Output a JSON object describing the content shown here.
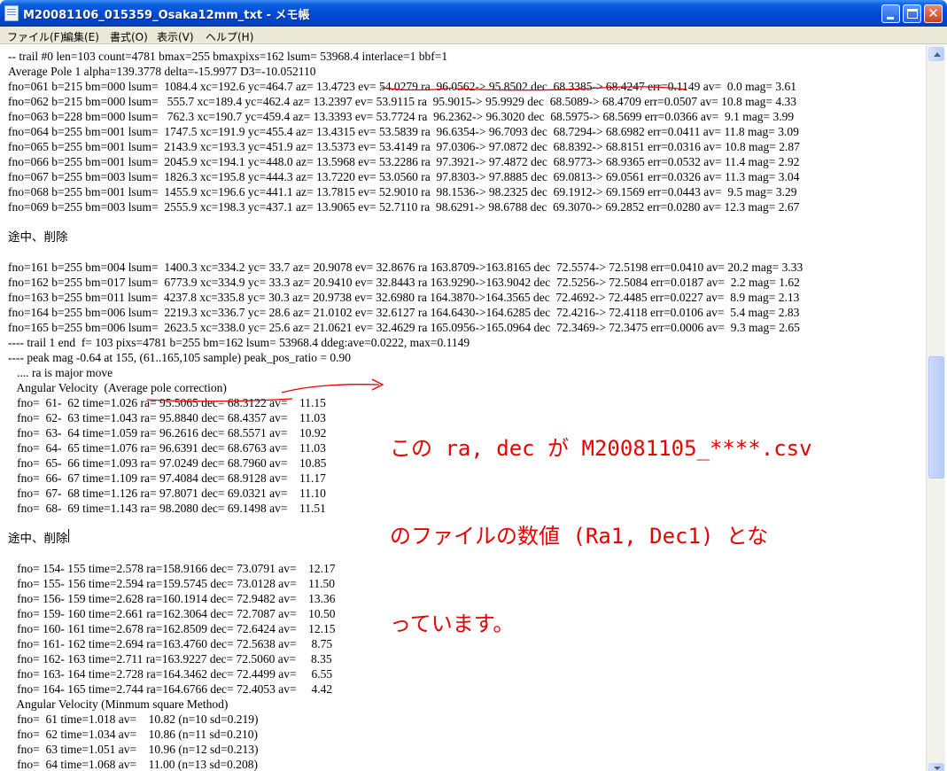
{
  "window": {
    "title": "M20081106_015359_Osaka12mm_txt - メモ帳"
  },
  "menu": [
    "ファイル(F)",
    "編集(E)",
    "書式(O)",
    "表示(V)",
    "ヘルプ(H)"
  ],
  "lines": [
    "-- trail #0 len=103 count=4781 bmax=255 bmaxpixs=162 lsum= 53968.4 interlace=1 bbf=1",
    "Average Pole 1 alpha=139.3778 delta=-15.9977 D3=-10.052110",
    "fno=061 b=215 bm=000 lsum=  1084.4 xc=192.6 yc=464.7 az= 13.4723 ev= 54.0279 ra  96.0562-> 95.8502 dec  68.3385-> 68.4247 err=0.1149 av=  0.0 mag= 3.61",
    "fno=062 b=215 bm=000 lsum=   555.7 xc=189.4 yc=462.4 az= 13.2397 ev= 53.9115 ra  95.9015-> 95.9929 dec  68.5089-> 68.4709 err=0.0507 av= 10.8 mag= 4.33",
    "fno=063 b=228 bm=000 lsum=   762.3 xc=190.7 yc=459.4 az= 13.3393 ev= 53.7724 ra  96.2362-> 96.3020 dec  68.5975-> 68.5699 err=0.0366 av=  9.1 mag= 3.99",
    "fno=064 b=255 bm=001 lsum=  1747.5 xc=191.9 yc=455.4 az= 13.4315 ev= 53.5839 ra  96.6354-> 96.7093 dec  68.7294-> 68.6982 err=0.0411 av= 11.8 mag= 3.09",
    "fno=065 b=255 bm=001 lsum=  2143.9 xc=193.3 yc=451.9 az= 13.5373 ev= 53.4149 ra  97.0306-> 97.0872 dec  68.8392-> 68.8151 err=0.0316 av= 10.8 mag= 2.87",
    "fno=066 b=255 bm=001 lsum=  2045.9 xc=194.1 yc=448.0 az= 13.5968 ev= 53.2286 ra  97.3921-> 97.4872 dec  68.9773-> 68.9365 err=0.0532 av= 11.4 mag= 2.92",
    "fno=067 b=255 bm=003 lsum=  1826.3 xc=195.8 yc=444.3 az= 13.7220 ev= 53.0560 ra  97.8303-> 97.8885 dec  69.0813-> 69.0561 err=0.0326 av= 11.3 mag= 3.04",
    "fno=068 b=255 bm=001 lsum=  1455.9 xc=196.6 yc=441.1 az= 13.7815 ev= 52.9010 ra  98.1536-> 98.2325 dec  69.1912-> 69.1569 err=0.0443 av=  9.5 mag= 3.29",
    "fno=069 b=255 bm=003 lsum=  2555.9 xc=198.3 yc=437.1 az= 13.9065 ev= 52.7110 ra  98.6291-> 98.6788 dec  69.3070-> 69.2852 err=0.0280 av= 12.3 mag= 2.67",
    "",
    "途中、削除",
    "",
    "fno=161 b=255 bm=004 lsum=  1400.3 xc=334.2 yc= 33.7 az= 20.9078 ev= 32.8676 ra 163.8709->163.8165 dec  72.5574-> 72.5198 err=0.0410 av= 20.2 mag= 3.33",
    "fno=162 b=255 bm=017 lsum=  6773.9 xc=334.9 yc= 33.3 az= 20.9410 ev= 32.8443 ra 163.9290->163.9042 dec  72.5256-> 72.5084 err=0.0187 av=  2.2 mag= 1.62",
    "fno=163 b=255 bm=011 lsum=  4237.8 xc=335.8 yc= 30.3 az= 20.9738 ev= 32.6980 ra 164.3870->164.3565 dec  72.4692-> 72.4485 err=0.0227 av=  8.9 mag= 2.13",
    "fno=164 b=255 bm=006 lsum=  2219.3 xc=336.7 yc= 28.6 az= 21.0102 ev= 32.6127 ra 164.6430->164.6285 dec  72.4216-> 72.4118 err=0.0106 av=  5.4 mag= 2.83",
    "fno=165 b=255 bm=006 lsum=  2623.5 xc=338.0 yc= 25.6 az= 21.0621 ev= 32.4629 ra 165.0956->165.0964 dec  72.3469-> 72.3475 err=0.0006 av=  9.3 mag= 2.65",
    "---- trail 1 end  f= 103 pixs=4781 b=255 bm=162 lsum= 53968.4 ddeg:ave=0.0222, max=0.1149",
    "---- peak mag -0.64 at 155, (61..165,105 sample) peak_pos_ratio = 0.90",
    "   .... ra is major move",
    "   Angular Velocity  (Average pole correction)",
    "   fno=  61-  62 time=1.026 ra= 95.5065 dec= 68.3122 av=    11.15",
    "   fno=  62-  63 time=1.043 ra= 95.8840 dec= 68.4357 av=    11.03",
    "   fno=  63-  64 time=1.059 ra= 96.2616 dec= 68.5571 av=    10.92",
    "   fno=  64-  65 time=1.076 ra= 96.6391 dec= 68.6763 av=    11.03",
    "   fno=  65-  66 time=1.093 ra= 97.0249 dec= 68.7960 av=    10.85",
    "   fno=  66-  67 time=1.109 ra= 97.4084 dec= 68.9128 av=    11.17",
    "   fno=  67-  68 time=1.126 ra= 97.8071 dec= 69.0321 av=    11.10",
    "   fno=  68-  69 time=1.143 ra= 98.2080 dec= 69.1498 av=    11.51",
    "",
    "途中、削除",
    "",
    "   fno= 154- 155 time=2.578 ra=158.9166 dec= 73.0791 av=    12.17",
    "   fno= 155- 156 time=2.594 ra=159.5745 dec= 73.0128 av=    11.50",
    "   fno= 156- 159 time=2.628 ra=160.1914 dec= 72.9482 av=    13.36",
    "   fno= 159- 160 time=2.661 ra=162.3064 dec= 72.7087 av=    10.50",
    "   fno= 160- 161 time=2.678 ra=162.8509 dec= 72.6424 av=    12.15",
    "   fno= 161- 162 time=2.694 ra=163.4760 dec= 72.5638 av=     8.75",
    "   fno= 162- 163 time=2.711 ra=163.9227 dec= 72.5060 av=     8.35",
    "   fno= 163- 164 time=2.728 ra=164.3462 dec= 72.4499 av=     6.55",
    "   fno= 164- 165 time=2.744 ra=164.6766 dec= 72.4053 av=     4.42",
    "   Angular Velocity (Minmum square Method)",
    "   fno=  61 time=1.018 av=    10.82 (n=10 sd=0.219)",
    "   fno=  62 time=1.034 av=    10.86 (n=11 sd=0.210)",
    "   fno=  63 time=1.051 av=    10.96 (n=12 sd=0.213)",
    "   fno=  64 time=1.068 av=    11.00 (n=13 sd=0.208)"
  ],
  "annotation": {
    "line1": "この ra, dec が M20081105_****.csv",
    "line2": "のファイルの数値 (Ra1, Dec1) とな",
    "line3": "っています。",
    "color": "#e60000"
  }
}
